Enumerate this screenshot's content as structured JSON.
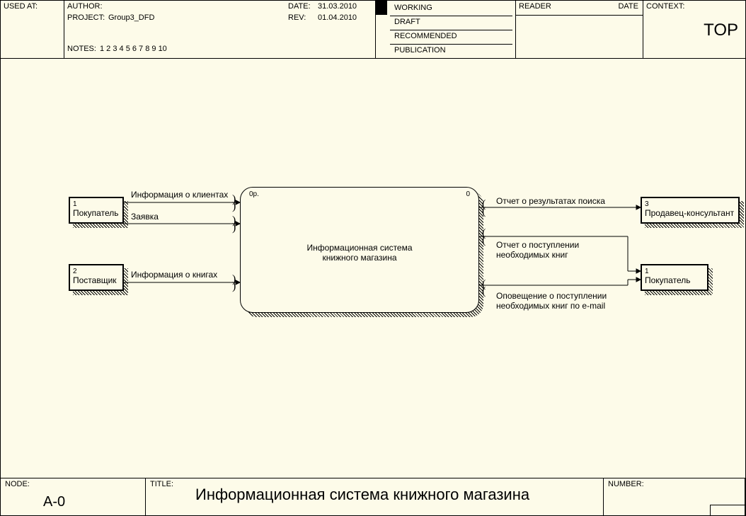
{
  "header": {
    "used_at_label": "USED AT:",
    "author_label": "AUTHOR:",
    "project_label": "PROJECT:",
    "project_value": "Group3_DFD",
    "date_label": "DATE:",
    "date_value": "31.03.2010",
    "rev_label": "REV:",
    "rev_value": "01.04.2010",
    "notes_label": "NOTES:",
    "notes_value": "1  2  3  4  5  6  7  8  9  10",
    "status": {
      "working": "WORKING",
      "draft": "DRAFT",
      "recommended": "RECOMMENDED",
      "publication": "PUBLICATION"
    },
    "reader_label": "READER",
    "reader_date_label": "DATE",
    "context_label": "CONTEXT:",
    "context_value": "TOP"
  },
  "footer": {
    "node_label": "NODE:",
    "node_value": "A-0",
    "title_label": "TITLE:",
    "title_value": "Информационная система книжного магазина",
    "number_label": "NUMBER:"
  },
  "entities": {
    "buyer_left": {
      "index": "1",
      "label": "Покупатель"
    },
    "supplier": {
      "index": "2",
      "label": "Поставщик"
    },
    "seller": {
      "index": "3",
      "label": "Продавец-консультант"
    },
    "buyer_right": {
      "index": "1",
      "label": "Покупатель"
    }
  },
  "process": {
    "left_corner": "0р.",
    "right_corner": "0",
    "label_line1": "Информационная система",
    "label_line2": "книжного магазина"
  },
  "flows": {
    "in1": "Информация о клиентах",
    "in2": "Заявка",
    "in3": "Информация о книгах",
    "out1": "Отчет о результатах поиска",
    "out2_line1": "Отчет о поступлении",
    "out2_line2": "необходимых книг",
    "out3_line1": "Оповещение о поступлении",
    "out3_line2": "необходимых книг по e-mail"
  }
}
